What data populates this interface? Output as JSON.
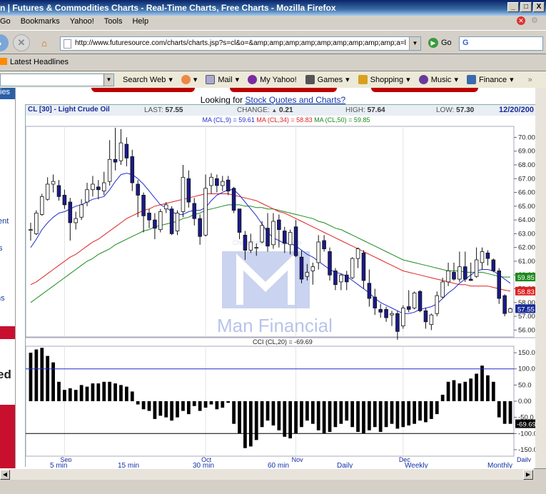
{
  "window": {
    "title": "n | Futures & Commodities Charts - Real-Time Charts, Free Charts - Mozilla Firefox",
    "buttons": [
      "_",
      "□",
      "X"
    ]
  },
  "menu": [
    "Go",
    "Bookmarks",
    "Yahoo!",
    "Tools",
    "Help"
  ],
  "nav": {
    "url": "http://www.futuresource.com/charts/charts.jsp?s=cl&o=&amp;amp;amp;amp;amp;amp;amp;amp;amp;a=l",
    "go_label": "Go",
    "search_letter": "G"
  },
  "bookmarks": {
    "latest": "Latest Headlines"
  },
  "yahoo_toolbar": {
    "search_web": "Search Web",
    "items": [
      "Mail",
      "My Yahoo!",
      "Games",
      "Shopping",
      "Music",
      "Finance"
    ]
  },
  "left_strip": [
    "ies",
    "tent",
    "s",
    "ms",
    "ed"
  ],
  "page": {
    "looking_prefix": "Looking for",
    "looking_link": "Stock Quotes and Charts?"
  },
  "chart_header": {
    "symbol": "CL [30] - Light Crude Oil",
    "last_label": "LAST:",
    "last": "57.55",
    "change_label": "CHANGE:",
    "change": "0.21",
    "high_label": "HIGH:",
    "high": "57.64",
    "low_label": "LOW:",
    "low": "57.30",
    "date": "12/20/200"
  },
  "ma_legend": {
    "ma9": "MA (CL,9) = 59.61",
    "ma34": "MA (CL,34) = 58.83",
    "ma50": "MA (CL,50) = 59.85"
  },
  "colors": {
    "ma9": "#1f2fd0",
    "ma34": "#e02020",
    "ma50": "#1a8a1a",
    "candle_up": "#ffffff",
    "candle_down": "#1a1a8a",
    "watermark": "#b8c4ea"
  },
  "watermark": {
    "text": "Man Financial",
    "small": "Chart: futuresource.com"
  },
  "cci_label": "CCI (CL,20) = -69.69",
  "price_tags": {
    "ma50": "59.85",
    "ma34": "58.83",
    "last": "57.55"
  },
  "cci_tag": "-69.69",
  "bottom_links": [
    "5 min",
    "15 min",
    "30 min",
    "60 min",
    "Daily",
    "Weekly",
    "Monthly"
  ],
  "chart_data": {
    "type": "line",
    "price_axis": {
      "ylim": [
        55.5,
        70.8
      ],
      "ticks": [
        "70.00",
        "69.00",
        "68.00",
        "67.00",
        "66.00",
        "65.00",
        "64.00",
        "63.00",
        "62.00",
        "61.00",
        "60.00",
        "59.00",
        "58.00",
        "57.00",
        "56.00"
      ]
    },
    "cci_axis": {
      "ylim": [
        -170,
        170
      ],
      "ticks": [
        "150.0",
        "100.0",
        "50.0",
        "0.00",
        "-50.0",
        "-100.0",
        "-150.0"
      ],
      "reference_lines": [
        100,
        -100
      ]
    },
    "x_labels": [
      "Sep",
      "Oct",
      "Nov",
      "Dec",
      "Daily"
    ],
    "x_label_positions": [
      6,
      31,
      47,
      66
    ],
    "candles": [
      [
        63.3,
        63.3,
        62.5,
        63.8
      ],
      [
        63.0,
        64.5,
        62.9,
        64.7
      ],
      [
        64.4,
        65.7,
        64.3,
        65.9
      ],
      [
        65.5,
        66.6,
        65.4,
        67.1
      ],
      [
        66.6,
        66.8,
        66.0,
        67.3
      ],
      [
        66.5,
        65.7,
        65.4,
        66.9
      ],
      [
        65.8,
        65.1,
        64.8,
        66.2
      ],
      [
        65.3,
        63.8,
        62.5,
        65.6
      ],
      [
        63.8,
        64.1,
        63.3,
        64.6
      ],
      [
        64.2,
        65.1,
        64.0,
        65.5
      ],
      [
        65.3,
        66.2,
        65.0,
        66.7
      ],
      [
        66.2,
        66.6,
        65.7,
        67.2
      ],
      [
        66.4,
        66.2,
        65.5,
        66.9
      ],
      [
        66.1,
        66.7,
        65.8,
        67.5
      ],
      [
        66.8,
        68.4,
        66.5,
        69.8
      ],
      [
        68.4,
        68.2,
        67.6,
        70.7
      ],
      [
        68.3,
        69.6,
        68.0,
        70.6
      ],
      [
        69.5,
        68.5,
        67.9,
        70.0
      ],
      [
        68.6,
        66.7,
        66.1,
        69.1
      ],
      [
        66.6,
        65.8,
        64.2,
        66.9
      ],
      [
        65.8,
        64.3,
        63.1,
        66.0
      ],
      [
        64.5,
        64.0,
        63.4,
        64.8
      ],
      [
        64.0,
        63.4,
        62.6,
        64.5
      ],
      [
        63.3,
        64.6,
        63.1,
        64.8
      ],
      [
        64.8,
        65.1,
        64.5,
        65.3
      ],
      [
        64.8,
        63.0,
        62.9,
        65.0
      ],
      [
        63.2,
        64.5,
        62.9,
        64.7
      ],
      [
        64.6,
        67.1,
        64.2,
        68.0
      ],
      [
        67.0,
        65.3,
        64.9,
        67.6
      ],
      [
        65.2,
        64.1,
        63.6,
        65.6
      ],
      [
        64.1,
        62.8,
        62.2,
        64.4
      ],
      [
        62.9,
        66.3,
        62.8,
        67.3
      ],
      [
        66.5,
        67.1,
        65.9,
        67.4
      ],
      [
        67.0,
        66.5,
        66.0,
        67.3
      ],
      [
        66.5,
        66.8,
        66.1,
        67.2
      ],
      [
        66.9,
        66.1,
        65.8,
        67.2
      ],
      [
        66.3,
        64.7,
        64.5,
        66.4
      ],
      [
        64.8,
        63.1,
        62.6,
        64.8
      ],
      [
        62.9,
        61.8,
        61.1,
        63.2
      ],
      [
        61.8,
        62.4,
        61.6,
        63.0
      ],
      [
        62.0,
        62.0,
        61.4,
        62.3
      ],
      [
        62.4,
        63.6,
        62.3,
        63.9
      ],
      [
        63.4,
        62.1,
        61.7,
        64.5
      ],
      [
        62.2,
        63.9,
        61.9,
        64.5
      ],
      [
        64.0,
        63.3,
        62.0,
        64.4
      ],
      [
        63.2,
        62.3,
        61.6,
        63.5
      ],
      [
        62.2,
        63.1,
        61.5,
        63.3
      ],
      [
        63.5,
        61.4,
        61.3,
        64.0
      ],
      [
        61.3,
        59.7,
        59.4,
        61.8
      ],
      [
        59.9,
        60.2,
        59.6,
        60.8
      ],
      [
        60.3,
        60.6,
        59.3,
        60.9
      ],
      [
        60.9,
        62.4,
        60.4,
        62.9
      ],
      [
        62.5,
        61.9,
        61.7,
        62.9
      ],
      [
        61.7,
        60.0,
        59.6,
        62.0
      ],
      [
        60.3,
        59.3,
        58.9,
        60.5
      ],
      [
        59.5,
        60.0,
        58.9,
        60.1
      ],
      [
        60.0,
        59.5,
        58.9,
        60.3
      ],
      [
        59.8,
        61.2,
        59.7,
        61.3
      ],
      [
        61.2,
        61.9,
        60.5,
        62.0
      ],
      [
        61.6,
        59.6,
        59.0,
        61.8
      ],
      [
        59.4,
        58.3,
        57.7,
        60.4
      ],
      [
        58.4,
        57.6,
        57.1,
        59.0
      ],
      [
        57.5,
        57.3,
        56.9,
        57.9
      ],
      [
        57.5,
        56.9,
        56.6,
        57.7
      ],
      [
        57.1,
        57.2,
        56.3,
        57.4
      ],
      [
        57.2,
        55.9,
        55.3,
        57.4
      ],
      [
        56.3,
        57.6,
        56.1,
        57.8
      ],
      [
        57.7,
        57.5,
        57.3,
        58.9
      ],
      [
        57.6,
        58.7,
        57.5,
        58.8
      ],
      [
        58.8,
        57.4,
        57.3,
        58.9
      ],
      [
        57.4,
        56.6,
        56.1,
        57.6
      ],
      [
        56.4,
        57.1,
        56.0,
        57.2
      ],
      [
        57.2,
        58.5,
        57.0,
        58.8
      ],
      [
        58.4,
        59.5,
        58.3,
        59.8
      ],
      [
        59.5,
        60.3,
        59.2,
        60.9
      ],
      [
        60.2,
        59.7,
        59.6,
        60.9
      ],
      [
        59.7,
        60.6,
        59.5,
        61.7
      ],
      [
        60.6,
        59.7,
        59.5,
        61.7
      ],
      [
        59.7,
        59.6,
        59.6,
        60.9
      ],
      [
        59.9,
        61.1,
        59.8,
        62.0
      ],
      [
        60.9,
        61.7,
        60.4,
        62.0
      ],
      [
        61.6,
        61.2,
        60.7,
        61.8
      ],
      [
        61.1,
        60.3,
        60.2,
        61.2
      ],
      [
        60.3,
        58.3,
        57.9,
        60.5
      ],
      [
        58.5,
        57.2,
        57.0,
        58.6
      ],
      [
        57.3,
        57.55,
        57.3,
        57.64
      ]
    ],
    "ma9": [
      62.0,
      62.6,
      63.3,
      63.8,
      64.2,
      64.5,
      64.6,
      64.8,
      65.0,
      65.1,
      65.3,
      65.5,
      65.6,
      65.7,
      66.2,
      66.8,
      67.3,
      67.4,
      67.3,
      67.0,
      66.6,
      66.1,
      65.6,
      65.1,
      64.9,
      64.6,
      64.4,
      64.4,
      64.6,
      64.7,
      64.7,
      64.9,
      65.4,
      65.8,
      66.0,
      66.2,
      66.2,
      65.8,
      65.3,
      64.8,
      64.3,
      63.7,
      63.1,
      62.7,
      62.5,
      62.3,
      62.3,
      62.1,
      61.8,
      61.5,
      61.3,
      61.0,
      60.7,
      60.4,
      60.2,
      60.1,
      59.9,
      59.6,
      59.3,
      59.0,
      58.7,
      58.3,
      58.0,
      57.8,
      57.6,
      57.4,
      57.2,
      57.2,
      57.3,
      57.5,
      57.6,
      57.7,
      57.9,
      58.3,
      58.7,
      59.0,
      59.4,
      59.7,
      60.0,
      60.3,
      60.4,
      60.4,
      60.3,
      60.0,
      59.7,
      59.4
    ],
    "ma34": [
      59.3,
      59.5,
      59.8,
      60.1,
      60.4,
      60.7,
      61.0,
      61.3,
      61.5,
      61.8,
      62.1,
      62.4,
      62.6,
      62.9,
      63.2,
      63.5,
      63.8,
      64.1,
      64.3,
      64.5,
      64.7,
      64.8,
      65.0,
      65.1,
      65.2,
      65.3,
      65.4,
      65.5,
      65.6,
      65.7,
      65.8,
      65.9,
      65.9,
      65.9,
      65.9,
      65.9,
      65.8,
      65.7,
      65.6,
      65.5,
      65.4,
      65.2,
      65.0,
      64.8,
      64.6,
      64.5,
      64.3,
      64.1,
      63.9,
      63.7,
      63.5,
      63.3,
      63.1,
      62.9,
      62.7,
      62.5,
      62.3,
      62.1,
      61.9,
      61.7,
      61.5,
      61.3,
      61.1,
      60.9,
      60.7,
      60.5,
      60.3,
      60.2,
      60.1,
      60.0,
      59.9,
      59.8,
      59.7,
      59.6,
      59.5,
      59.4,
      59.3,
      59.3,
      59.2,
      59.2,
      59.2,
      59.2,
      59.1,
      59.0,
      58.9,
      58.83
    ],
    "ma50": [
      58.0,
      58.3,
      58.6,
      58.9,
      59.2,
      59.5,
      59.8,
      60.1,
      60.4,
      60.7,
      61.0,
      61.2,
      61.5,
      61.7,
      61.9,
      62.2,
      62.4,
      62.6,
      62.8,
      63.0,
      63.2,
      63.3,
      63.5,
      63.6,
      63.7,
      63.8,
      63.9,
      64.1,
      64.2,
      64.4,
      64.5,
      64.7,
      64.8,
      64.9,
      65.0,
      65.1,
      65.1,
      65.1,
      65.0,
      65.0,
      64.9,
      64.9,
      64.8,
      64.8,
      64.7,
      64.6,
      64.5,
      64.4,
      64.3,
      64.2,
      64.1,
      63.9,
      63.8,
      63.6,
      63.4,
      63.3,
      63.1,
      62.9,
      62.7,
      62.5,
      62.3,
      62.1,
      61.9,
      61.7,
      61.5,
      61.3,
      61.1,
      61.0,
      60.9,
      60.8,
      60.7,
      60.6,
      60.5,
      60.4,
      60.3,
      60.3,
      60.3,
      60.2,
      60.2,
      60.2,
      60.2,
      60.1,
      60.0,
      59.9,
      59.85,
      59.85
    ],
    "cci": [
      150,
      160,
      165,
      140,
      120,
      60,
      35,
      40,
      35,
      50,
      45,
      55,
      55,
      60,
      60,
      55,
      50,
      45,
      30,
      -10,
      -25,
      -30,
      -55,
      -45,
      -50,
      -60,
      -50,
      -30,
      -40,
      -15,
      -30,
      -20,
      -10,
      -25,
      -20,
      -5,
      -70,
      -100,
      -145,
      -140,
      -120,
      -80,
      -60,
      -75,
      -90,
      -110,
      -115,
      -100,
      -80,
      -60,
      -70,
      -90,
      -100,
      -95,
      -80,
      -70,
      -60,
      -80,
      -95,
      -100,
      -90,
      -80,
      -95,
      -80,
      -70,
      -85,
      -80,
      -75,
      -70,
      -60,
      -65,
      -55,
      -40,
      20,
      60,
      65,
      55,
      60,
      70,
      85,
      110,
      80,
      60,
      -50,
      -70,
      -70
    ]
  }
}
